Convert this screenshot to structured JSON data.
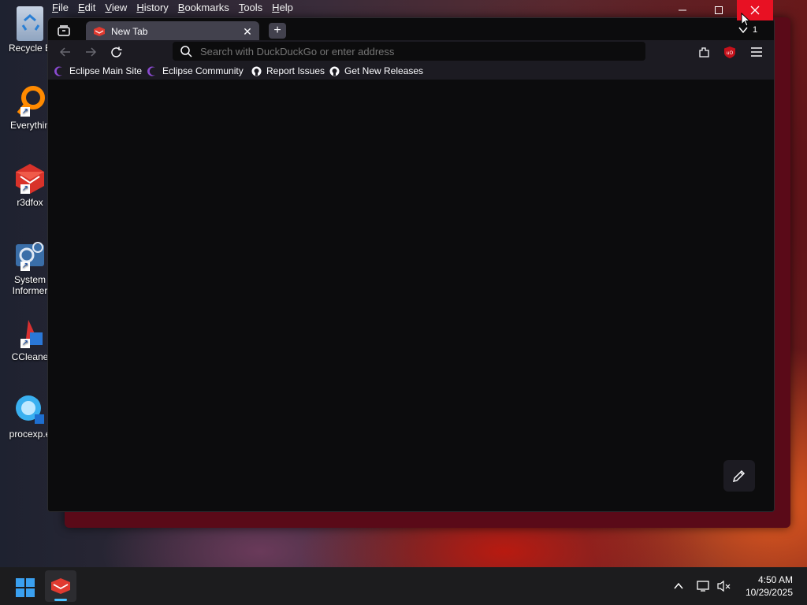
{
  "desktop": {
    "icons": [
      {
        "label": "Recycle B",
        "icon": "recycle-bin-icon"
      },
      {
        "label": "Everythin",
        "icon": "everything-search-icon"
      },
      {
        "label": "r3dfox",
        "icon": "r3dfox-icon"
      },
      {
        "label": "System Informer",
        "label_line1": "System",
        "label_line2": "Informer",
        "icon": "system-informer-icon"
      },
      {
        "label": "CCleane",
        "icon": "ccleaner-icon"
      },
      {
        "label": "procexp.e",
        "icon": "procexp-icon"
      }
    ]
  },
  "menubar": {
    "items": [
      "File",
      "Edit",
      "View",
      "History",
      "Bookmarks",
      "Tools",
      "Help"
    ]
  },
  "browser": {
    "tab": {
      "title": "New Tab"
    },
    "new_tab_label": "+",
    "urlbar": {
      "placeholder": "Search with DuckDuckGo or enter address"
    },
    "downloads_count": "1",
    "bookmarks": [
      {
        "label": "Eclipse Main Site",
        "icon": "eclipse-icon"
      },
      {
        "label": "Eclipse Community",
        "icon": "eclipse-icon"
      },
      {
        "label": "Report Issues",
        "icon": "github-icon"
      },
      {
        "label": "Get New Releases",
        "icon": "github-icon"
      }
    ],
    "colors": {
      "content_bg": "#0c0c0d",
      "toolbar_bg": "#1c1b22",
      "close_button": "#e81123"
    }
  },
  "taskbar": {
    "time": "4:50 AM",
    "date": "10/29/2025"
  }
}
